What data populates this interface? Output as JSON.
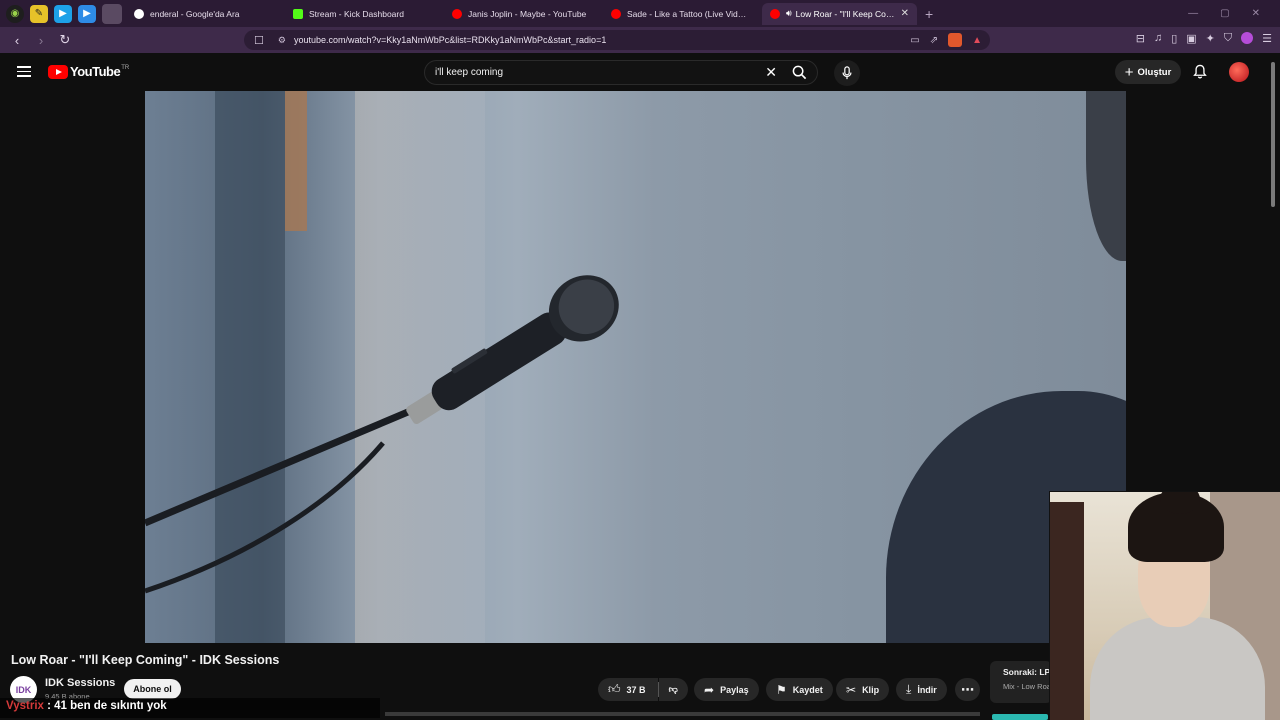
{
  "browser": {
    "tabs": [
      {
        "title": "enderal - Google'da Ara",
        "favicon_color": "#ffffff"
      },
      {
        "title": "Stream - Kick Dashboard",
        "favicon_color": "#53fc18"
      },
      {
        "title": "Janis Joplin - Maybe - YouTube",
        "favicon_color": "#ff0000"
      },
      {
        "title": "Sade - Like a Tattoo (Live Video from",
        "favicon_color": "#ff0000"
      },
      {
        "title": "Low Roar - \"I'll Keep Coming\"",
        "favicon_color": "#ff0000",
        "active": true
      }
    ],
    "url": "youtube.com/watch?v=Kky1aNmWbPc&list=RDKky1aNmWbPc&start_radio=1"
  },
  "youtube": {
    "logo_text": "YouTube",
    "country_code": "TR",
    "search_value": "i'll keep coming",
    "create_label": "Oluştur"
  },
  "video": {
    "title": "Low Roar - \"I'll Keep Coming\" - IDK Sessions",
    "channel": "IDK Sessions",
    "channel_avatar_text": "IDK",
    "subscribers": "9,45 B abone",
    "subscribe_label": "Abone ol",
    "like_count": "37 B",
    "share_label": "Paylaş",
    "save_label": "Kaydet",
    "clip_label": "Klip",
    "download_label": "İndir"
  },
  "up_next": {
    "label": "Sonraki: LP",
    "subtitle": "Mix - Low Roar"
  },
  "chat_overlay": {
    "user": "Vystrix",
    "message": " : 41 ben de sıkıntı yok"
  },
  "colors": {
    "brand_red": "#ff0000",
    "browser_chrome": "#3e2a4a",
    "chat_user": "#d43a3a"
  }
}
